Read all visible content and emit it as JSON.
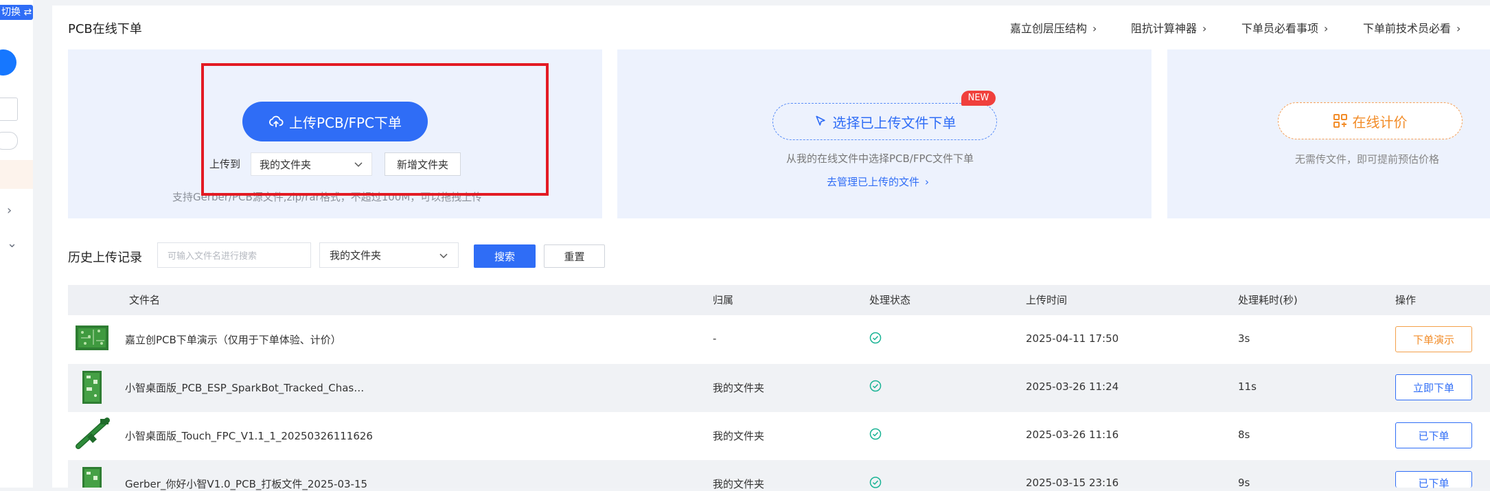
{
  "sidebar": {
    "switch_label": "切换 ⇄"
  },
  "header": {
    "title": "PCB在线下单",
    "links": [
      {
        "label": "嘉立创层压结构"
      },
      {
        "label": "阻抗计算神器"
      },
      {
        "label": "下单员必看事项"
      },
      {
        "label": "下单前技术员必看"
      }
    ]
  },
  "upload_card": {
    "upload_button": "上传PCB/FPC下单",
    "upload_to_label": "上传到",
    "folder_value": "我的文件夹",
    "new_folder_button": "新增文件夹",
    "hint": "支持Gerber/PCB源文件,zip/rar格式，不超过100M，可以拖拽上传"
  },
  "select_card": {
    "button": "选择已上传文件下单",
    "badge": "NEW",
    "description": "从我的在线文件中选择PCB/FPC文件下单",
    "manage_link": "去管理已上传的文件"
  },
  "quote_card": {
    "button": "在线计价",
    "description": "无需传文件，即可提前预估价格"
  },
  "history": {
    "title": "历史上传记录",
    "search_placeholder": "可输入文件名进行搜索",
    "folder_value": "我的文件夹",
    "search_button": "搜索",
    "reset_button": "重置"
  },
  "table": {
    "columns": [
      "文件名",
      "归属",
      "处理状态",
      "上传时间",
      "处理耗时(秒)",
      "操作"
    ],
    "rows": [
      {
        "name": "嘉立创PCB下单演示（仅用于下单体验、计价）",
        "owner": "-",
        "time": "2025-04-11 17:50",
        "duration": "3s",
        "action": "下单演示"
      },
      {
        "name": "小智桌面版_PCB_ESP_SparkBot_Tracked_Chas…",
        "owner": "我的文件夹",
        "time": "2025-03-26 11:24",
        "duration": "11s",
        "action": "立即下单"
      },
      {
        "name": "小智桌面版_Touch_FPC_V1.1_1_20250326111626",
        "owner": "我的文件夹",
        "time": "2025-03-26 11:16",
        "duration": "8s",
        "action": "已下单"
      },
      {
        "name": "Gerber_你好小智V1.0_PCB_打板文件_2025-03-15",
        "owner": "我的文件夹",
        "time": "2025-03-15 23:16",
        "duration": "9s",
        "action": "已下单"
      }
    ]
  },
  "colors": {
    "primary": "#2f6df6",
    "orange": "#f28c28",
    "highlight_red": "#e31b23",
    "success": "#19b394"
  }
}
